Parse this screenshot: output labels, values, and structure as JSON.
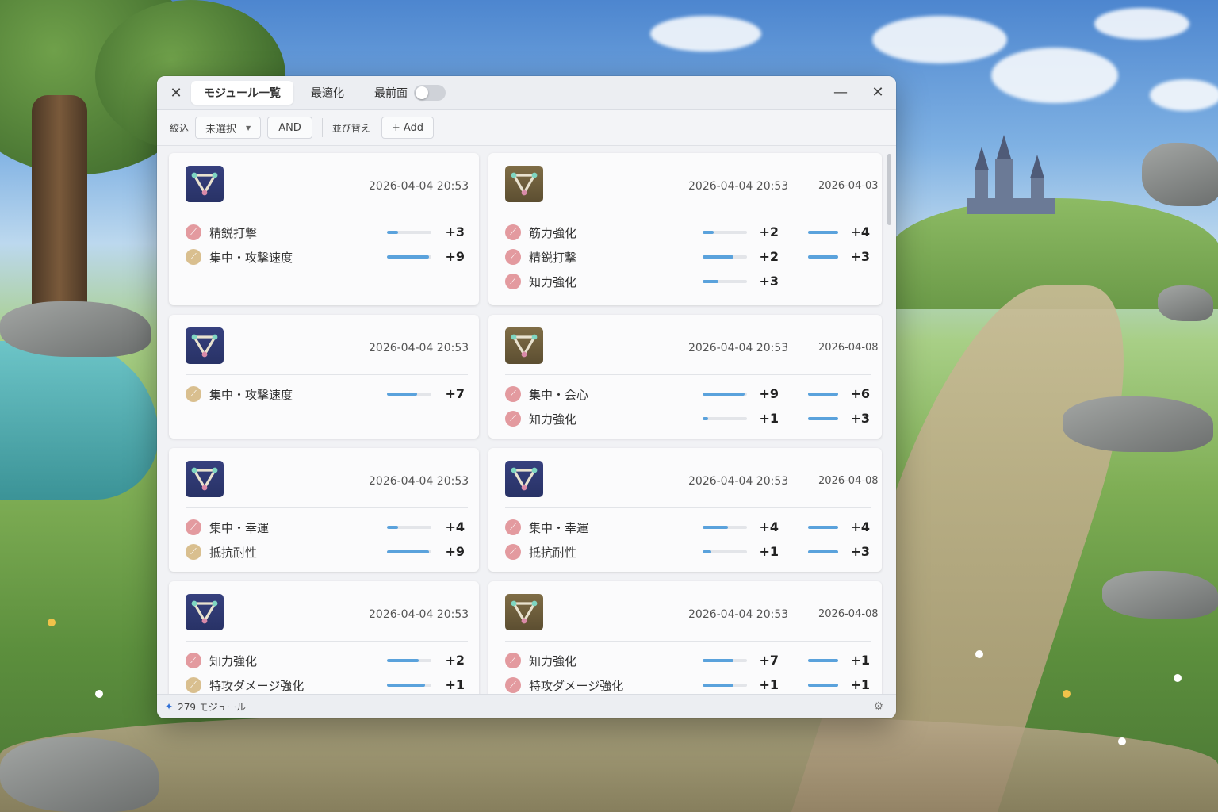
{
  "window": {
    "tabs": [
      {
        "label": "モジュール一覧",
        "active": true
      },
      {
        "label": "最適化",
        "active": false
      }
    ],
    "pin_label": "最前面",
    "pin_enabled": false
  },
  "filter": {
    "filter_label": "絞込",
    "select_value": "未選択",
    "logic_button": "AND",
    "sort_label": "並び替え",
    "add_button": "+ Add"
  },
  "cards": [
    {
      "icon": "module-triangle-icon",
      "tone": "blue",
      "date": "2026-04-04 20:53",
      "date2": "",
      "stats": [
        {
          "name": "精鋭打撃",
          "icon": "pink",
          "value": "+3",
          "level": 0.25,
          "value2": ""
        },
        {
          "name": "集中・攻撃速度",
          "icon": "tan",
          "value": "+9",
          "level": 0.95,
          "value2": ""
        }
      ]
    },
    {
      "icon": "module-triangle-icon",
      "tone": "gold",
      "date": "2026-04-04 20:53",
      "date2": "2026-04-03",
      "stats": [
        {
          "name": "筋力強化",
          "icon": "pink",
          "value": "+2",
          "level": 0.25,
          "value2": "+4"
        },
        {
          "name": "精鋭打撃",
          "icon": "pink",
          "value": "+2",
          "level": 0.7,
          "value2": "+3"
        },
        {
          "name": "知力強化",
          "icon": "pink",
          "value": "+3",
          "level": 0.35,
          "value2": ""
        }
      ]
    },
    {
      "icon": "module-triangle-icon",
      "tone": "blue",
      "date": "2026-04-04 20:53",
      "date2": "",
      "stats": [
        {
          "name": "集中・攻撃速度",
          "icon": "tan",
          "value": "+7",
          "level": 0.68,
          "value2": ""
        }
      ]
    },
    {
      "icon": "module-triangle-icon",
      "tone": "gold",
      "date": "2026-04-04 20:53",
      "date2": "2026-04-08",
      "stats": [
        {
          "name": "集中・会心",
          "icon": "pink",
          "value": "+9",
          "level": 0.95,
          "value2": "+6"
        },
        {
          "name": "知力強化",
          "icon": "pink",
          "value": "+1",
          "level": 0.12,
          "value2": "+3"
        }
      ]
    },
    {
      "icon": "module-triangle-icon",
      "tone": "blue",
      "date": "2026-04-04 20:53",
      "date2": "",
      "stats": [
        {
          "name": "集中・幸運",
          "icon": "pink",
          "value": "+4",
          "level": 0.25,
          "value2": ""
        },
        {
          "name": "抵抗耐性",
          "icon": "tan",
          "value": "+9",
          "level": 0.95,
          "value2": ""
        }
      ]
    },
    {
      "icon": "module-triangle-icon",
      "tone": "blue",
      "date": "2026-04-04 20:53",
      "date2": "2026-04-08",
      "stats": [
        {
          "name": "集中・幸運",
          "icon": "pink",
          "value": "+4",
          "level": 0.58,
          "value2": "+4"
        },
        {
          "name": "抵抗耐性",
          "icon": "pink",
          "value": "+1",
          "level": 0.2,
          "value2": "+3"
        }
      ]
    },
    {
      "icon": "module-triangle-icon",
      "tone": "blue",
      "date": "2026-04-04 20:53",
      "date2": "",
      "stats": [
        {
          "name": "知力強化",
          "icon": "pink",
          "value": "+2",
          "level": 0.72,
          "value2": ""
        },
        {
          "name": "特攻ダメージ強化",
          "icon": "tan",
          "value": "+1",
          "level": 0.85,
          "value2": ""
        }
      ]
    },
    {
      "icon": "module-triangle-icon",
      "tone": "gold",
      "date": "2026-04-04 20:53",
      "date2": "2026-04-08",
      "stats": [
        {
          "name": "知力強化",
          "icon": "pink",
          "value": "+7",
          "level": 0.7,
          "value2": "+1"
        },
        {
          "name": "特攻ダメージ強化",
          "icon": "pink",
          "value": "+1",
          "level": 0.7,
          "value2": "+1"
        }
      ]
    }
  ],
  "footer": {
    "count_text": "279 モジュール"
  },
  "colors": {
    "accent": "#5aa2dc",
    "card_blue": "#2f3a73",
    "card_gold": "#6e5e3c"
  }
}
